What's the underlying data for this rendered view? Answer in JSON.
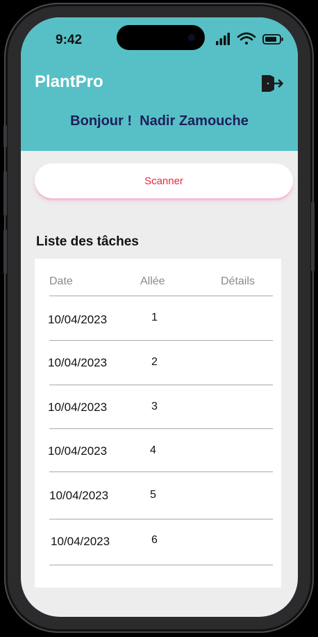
{
  "status_bar": {
    "time": "9:42"
  },
  "header": {
    "app_title": "PlantPro",
    "greeting": "Bonjour !  Nadir Zamouche",
    "logout_icon": "logout-door-icon",
    "background_color": "#57c0c6"
  },
  "scan_button": {
    "label": "Scanner",
    "text_color": "#e8293d"
  },
  "tasks": {
    "section_title": "Liste des tâches",
    "columns": [
      "Date",
      "Allée",
      "Détails"
    ],
    "rows": [
      {
        "date": "10/04/2023",
        "allee": "1"
      },
      {
        "date": "10/04/2023",
        "allee": "2"
      },
      {
        "date": "10/04/2023",
        "allee": "3"
      },
      {
        "date": "10/04/2023",
        "allee": "4"
      },
      {
        "date": "10/04/2023",
        "allee": "5"
      },
      {
        "date": "10/04/2023",
        "allee": "6"
      }
    ]
  }
}
